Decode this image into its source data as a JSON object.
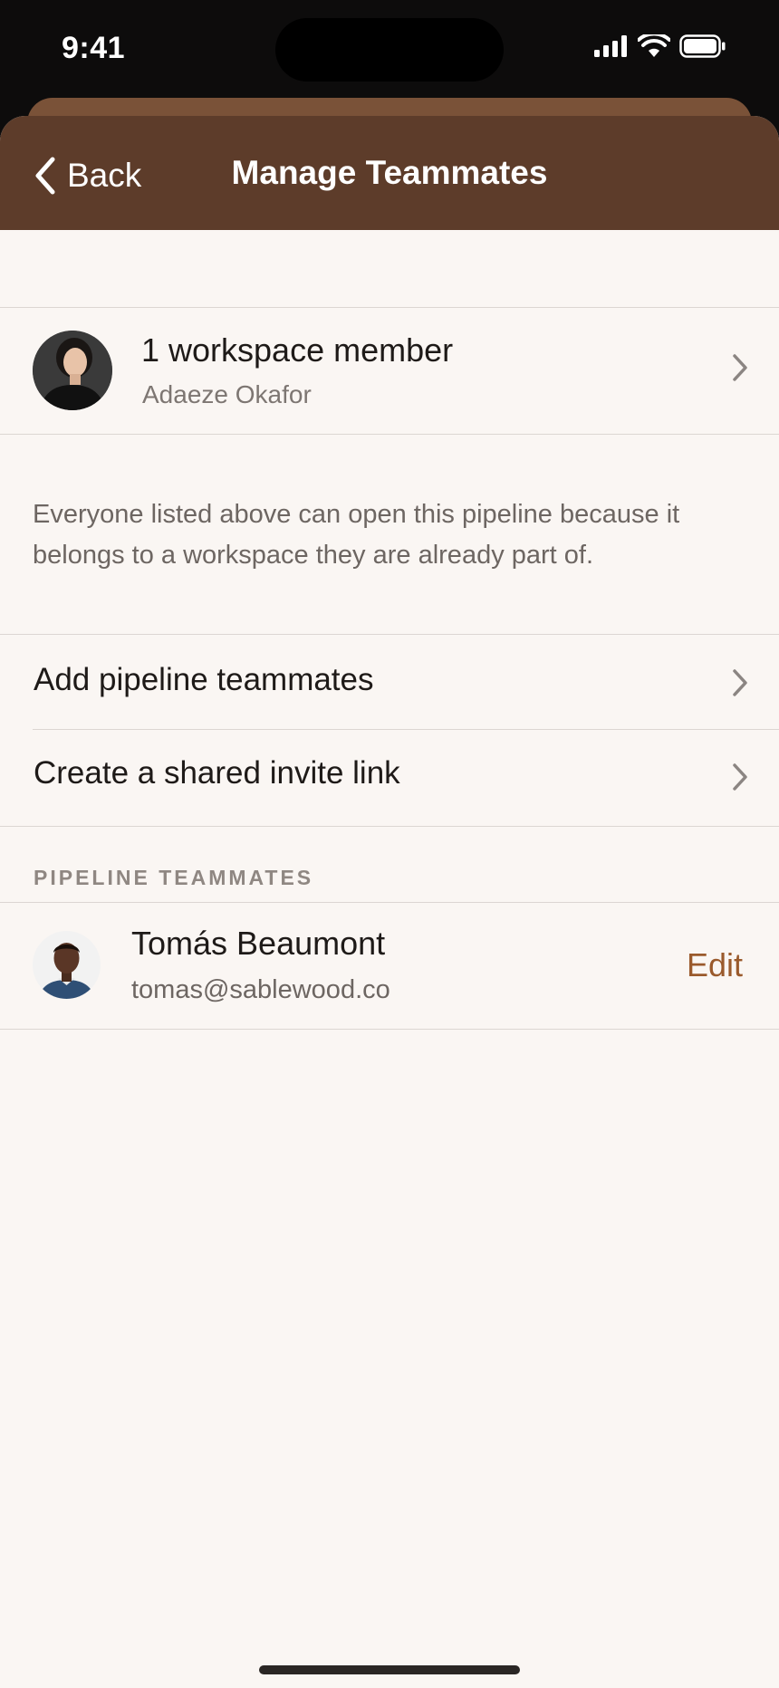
{
  "status_bar": {
    "time": "9:41"
  },
  "nav": {
    "back_label": "Back",
    "title": "Manage Teammates"
  },
  "workspace_members": {
    "title": "1 workspace member",
    "subtitle": "Adaeze Okafor"
  },
  "footnote": "Everyone listed above can open this pipeline because it belongs to a workspace they are already part of.",
  "actions": [
    {
      "label": "Add pipeline teammates"
    },
    {
      "label": "Create a shared invite link"
    }
  ],
  "teammates_section": {
    "header": "PIPELINE TEAMMATES",
    "items": [
      {
        "name": "Tomás Beaumont",
        "email": "tomas@sablewood.co",
        "action": "Edit"
      }
    ]
  },
  "colors": {
    "nav_background": "#5d3c2a",
    "accent": "#9a5a2c",
    "sheet_background": "#faf6f3"
  }
}
